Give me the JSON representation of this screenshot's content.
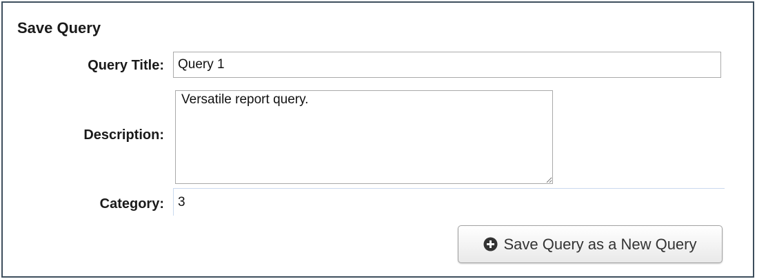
{
  "panel": {
    "title": "Save Query"
  },
  "form": {
    "query_title": {
      "label": "Query Title:",
      "value": "Query 1"
    },
    "description": {
      "label": "Description:",
      "value": "Versatile report query."
    },
    "category": {
      "label": "Category:",
      "value": "3"
    }
  },
  "actions": {
    "save_new_label": "Save Query as a New Query",
    "save_new_icon": "plus-circle-icon"
  },
  "colors": {
    "frame_border": "#3c4d5c",
    "icon": "#333333"
  }
}
